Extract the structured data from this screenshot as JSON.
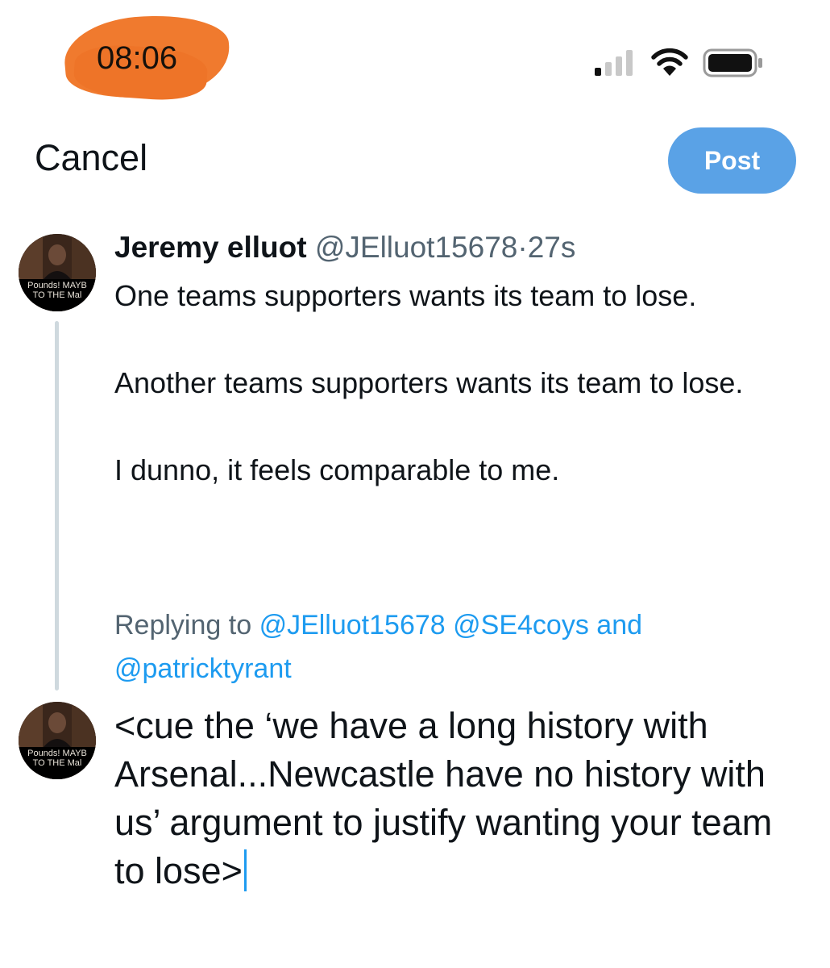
{
  "status_bar": {
    "time": "08:06",
    "icons": [
      "cellular-signal-icon",
      "wifi-icon",
      "battery-icon"
    ],
    "redaction_color": "#f07a2e"
  },
  "header": {
    "cancel_label": "Cancel",
    "post_label": "Post",
    "post_color": "#5aa2e6"
  },
  "original_tweet": {
    "author_name": "Jeremy elluot",
    "handle": "@JElluot15678",
    "separator": "·",
    "age": "27s",
    "paragraphs": [
      "One teams supporters wants its team to lose.",
      "Another teams supporters wants its team to lose.",
      "I dunno, it feels comparable to me."
    ],
    "avatar_caption": [
      "Pounds! MAYB",
      "TO THE Mal"
    ]
  },
  "reply_context": {
    "prefix": "Replying to",
    "mentions": [
      "@JElluot15678",
      "@SE4coys"
    ],
    "conjunction": "and",
    "last_mention": "@patricktyrant"
  },
  "composer": {
    "text": "<cue the ‘we have a long history with Arsenal...Newcastle have no history with us’ argument to justify wanting your team to lose>",
    "avatar_caption": [
      "Pounds! MAYB",
      "TO THE Mal"
    ],
    "caret_color": "#1d9bf0"
  },
  "colors": {
    "text_primary": "#0f1419",
    "text_secondary": "#536471",
    "link": "#1d9bf0",
    "thread_line": "#cfd9de"
  }
}
